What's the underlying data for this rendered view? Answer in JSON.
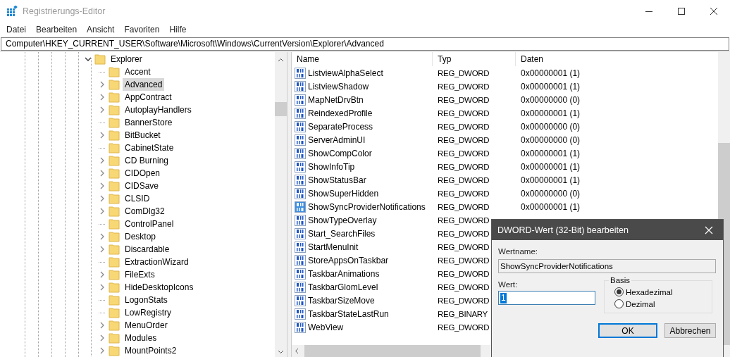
{
  "window": {
    "title": "Registrierungs-Editor"
  },
  "menu": [
    "Datei",
    "Bearbeiten",
    "Ansicht",
    "Favoriten",
    "Hilfe"
  ],
  "address": "Computer\\HKEY_CURRENT_USER\\Software\\Microsoft\\Windows\\CurrentVersion\\Explorer\\Advanced",
  "tree": {
    "label": "Explorer",
    "expanded": true,
    "children": [
      {
        "label": "Accent",
        "has_children": false,
        "selected": false
      },
      {
        "label": "Advanced",
        "has_children": true,
        "selected": true
      },
      {
        "label": "AppContract",
        "has_children": true,
        "selected": false
      },
      {
        "label": "AutoplayHandlers",
        "has_children": true,
        "selected": false
      },
      {
        "label": "BannerStore",
        "has_children": false,
        "selected": false
      },
      {
        "label": "BitBucket",
        "has_children": true,
        "selected": false
      },
      {
        "label": "CabinetState",
        "has_children": false,
        "selected": false
      },
      {
        "label": "CD Burning",
        "has_children": true,
        "selected": false
      },
      {
        "label": "CIDOpen",
        "has_children": true,
        "selected": false
      },
      {
        "label": "CIDSave",
        "has_children": true,
        "selected": false
      },
      {
        "label": "CLSID",
        "has_children": true,
        "selected": false
      },
      {
        "label": "ComDlg32",
        "has_children": true,
        "selected": false
      },
      {
        "label": "ControlPanel",
        "has_children": false,
        "selected": false
      },
      {
        "label": "Desktop",
        "has_children": true,
        "selected": false
      },
      {
        "label": "Discardable",
        "has_children": true,
        "selected": false
      },
      {
        "label": "ExtractionWizard",
        "has_children": false,
        "selected": false
      },
      {
        "label": "FileExts",
        "has_children": true,
        "selected": false
      },
      {
        "label": "HideDesktopIcons",
        "has_children": true,
        "selected": false
      },
      {
        "label": "LogonStats",
        "has_children": false,
        "selected": false
      },
      {
        "label": "LowRegistry",
        "has_children": false,
        "selected": false
      },
      {
        "label": "MenuOrder",
        "has_children": true,
        "selected": false
      },
      {
        "label": "Modules",
        "has_children": true,
        "selected": false
      },
      {
        "label": "MountPoints2",
        "has_children": true,
        "selected": false
      }
    ]
  },
  "list": {
    "columns": [
      "Name",
      "Typ",
      "Daten"
    ],
    "rows": [
      {
        "name": "ListviewAlphaSelect",
        "type": "REG_DWORD",
        "data": "0x00000001 (1)",
        "selected": false
      },
      {
        "name": "ListviewShadow",
        "type": "REG_DWORD",
        "data": "0x00000001 (1)",
        "selected": false
      },
      {
        "name": "MapNetDrvBtn",
        "type": "REG_DWORD",
        "data": "0x00000000 (0)",
        "selected": false
      },
      {
        "name": "ReindexedProfile",
        "type": "REG_DWORD",
        "data": "0x00000001 (1)",
        "selected": false
      },
      {
        "name": "SeparateProcess",
        "type": "REG_DWORD",
        "data": "0x00000000 (0)",
        "selected": false
      },
      {
        "name": "ServerAdminUI",
        "type": "REG_DWORD",
        "data": "0x00000000 (0)",
        "selected": false
      },
      {
        "name": "ShowCompColor",
        "type": "REG_DWORD",
        "data": "0x00000001 (1)",
        "selected": false
      },
      {
        "name": "ShowInfoTip",
        "type": "REG_DWORD",
        "data": "0x00000001 (1)",
        "selected": false
      },
      {
        "name": "ShowStatusBar",
        "type": "REG_DWORD",
        "data": "0x00000001 (1)",
        "selected": false
      },
      {
        "name": "ShowSuperHidden",
        "type": "REG_DWORD",
        "data": "0x00000000 (0)",
        "selected": false
      },
      {
        "name": "ShowSyncProviderNotifications",
        "type": "REG_DWORD",
        "data": "0x00000001 (1)",
        "selected": true
      },
      {
        "name": "ShowTypeOverlay",
        "type": "REG_DWORD",
        "selected": false
      },
      {
        "name": "Start_SearchFiles",
        "type": "REG_DWORD",
        "selected": false
      },
      {
        "name": "StartMenuInit",
        "type": "REG_DWORD",
        "selected": false
      },
      {
        "name": "StoreAppsOnTaskbar",
        "type": "REG_DWORD",
        "selected": false
      },
      {
        "name": "TaskbarAnimations",
        "type": "REG_DWORD",
        "selected": false
      },
      {
        "name": "TaskbarGlomLevel",
        "type": "REG_DWORD",
        "selected": false
      },
      {
        "name": "TaskbarSizeMove",
        "type": "REG_DWORD",
        "selected": false
      },
      {
        "name": "TaskbarStateLastRun",
        "type": "REG_BINARY",
        "selected": false
      },
      {
        "name": "WebView",
        "type": "REG_DWORD",
        "selected": false
      }
    ]
  },
  "dialog": {
    "title": "DWORD-Wert (32-Bit) bearbeiten",
    "name_label": "Wertname:",
    "name_value": "ShowSyncProviderNotifications",
    "value_label": "Wert:",
    "value": "1",
    "base_label": "Basis",
    "bases": [
      {
        "label": "Hexadezimal",
        "selected": true
      },
      {
        "label": "Dezimal",
        "selected": false
      }
    ],
    "buttons": [
      {
        "label": "OK",
        "default": true
      },
      {
        "label": "Abbrechen",
        "default": false
      }
    ]
  }
}
